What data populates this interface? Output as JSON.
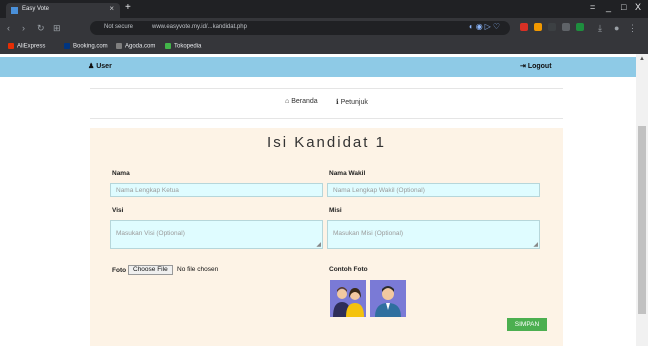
{
  "browser": {
    "tab_title": "Easy Vote",
    "tab_close": "×",
    "new_tab": "+",
    "controls": [
      "=",
      "_",
      "□",
      "X"
    ],
    "address": {
      "secure_text": "Not secure",
      "url": "www.easyvote.my.id/...kandidat.php"
    },
    "bookmarks": [
      {
        "label": "AliExpress",
        "color": "#e62e04"
      },
      {
        "label": "Booking.com",
        "color": "#003580"
      },
      {
        "label": "Agoda.com",
        "color": "#7f7f7f"
      },
      {
        "label": "Tokopedia",
        "color": "#42b549"
      }
    ]
  },
  "app": {
    "header": {
      "user_label": "User",
      "logout_label": "Logout"
    },
    "nav": {
      "home_label": "Beranda",
      "help_label": "Petunjuk"
    },
    "form": {
      "title": "Isi Kandidat 1",
      "name_label": "Nama",
      "name_placeholder": "Nama Lengkap Ketua",
      "vice_label": "Nama Wakil",
      "vice_placeholder": "Nama Lengkap Wakil (Optional)",
      "vision_label": "Visi",
      "vision_placeholder": "Masukan Visi (Optional)",
      "mission_label": "Misi",
      "mission_placeholder": "Masukan Misi (Optional)",
      "photo_label": "Foto",
      "file_button": "Choose File",
      "file_status": "No file chosen",
      "example_label": "Contoh Foto",
      "save_button": "SIMPAN"
    },
    "colors": {
      "header_bg": "#8ecae6",
      "panel_bg": "#fdf3e6",
      "input_bg": "#dffcff",
      "save_bg": "#4caf50",
      "photo_bg": "#7a7ad6"
    }
  }
}
